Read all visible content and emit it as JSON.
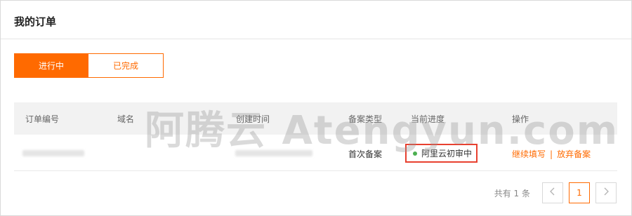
{
  "page": {
    "title": "我的订单"
  },
  "tabs": [
    {
      "label": "进行中",
      "active": true
    },
    {
      "label": "已完成",
      "active": false
    }
  ],
  "table": {
    "headers": [
      "订单编号",
      "域名",
      "创建时间",
      "备案类型",
      "当前进度",
      "操作"
    ],
    "rows": [
      {
        "filing_type": "首次备案",
        "progress": "阿里云初审中",
        "actions": [
          "继续填写",
          "放弃备案"
        ],
        "separator": "|"
      }
    ]
  },
  "pagination": {
    "total_text": "共有 1 条",
    "current_page": "1",
    "prev_icon": "chevron-left-icon",
    "next_icon": "chevron-right-icon"
  },
  "watermark": "阿腾云 Atengyun.com",
  "colors": {
    "accent": "#ff6a00",
    "status_dot": "#4caf50",
    "highlight_border": "#e8402f"
  }
}
